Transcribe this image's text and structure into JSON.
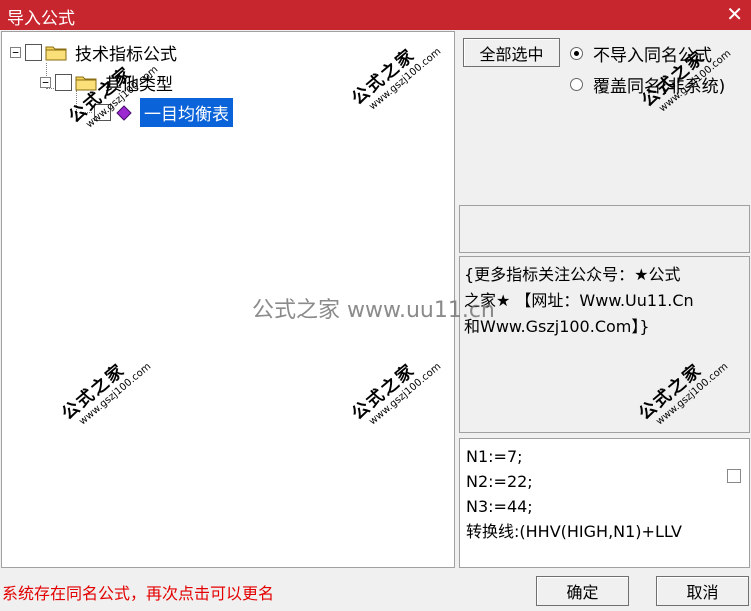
{
  "window": {
    "title": "导入公式"
  },
  "tree": {
    "root_label": "技术指标公式",
    "child_label": "其他类型",
    "leaf_label": "一目均衡表"
  },
  "controls": {
    "select_all_label": "全部选中",
    "radio_skip_label": "不导入同名公式",
    "radio_overwrite_label": "覆盖同名(非系统)"
  },
  "description": {
    "line1": "{更多指标关注公众号：★公式",
    "line2": "之家★ 【网址：Www.Uu11.Cn",
    "line3": "和Www.Gszj100.Com】}"
  },
  "code": [
    "N1:=7;",
    "N2:=22;",
    "N3:=44;",
    "转换线:(HHV(HIGH,N1)+LLV"
  ],
  "status_text": "系统存在同名公式，再次点击可以更名",
  "buttons": {
    "ok": "确定",
    "cancel": "取消"
  },
  "watermark": {
    "text_cn": "公式之家",
    "text_url": "www.gszj100.com",
    "center": "公式之家 www.uu11.cn"
  },
  "colors": {
    "title_bar": "#c8262e",
    "selection": "#0a63d8",
    "status": "#e30000"
  }
}
